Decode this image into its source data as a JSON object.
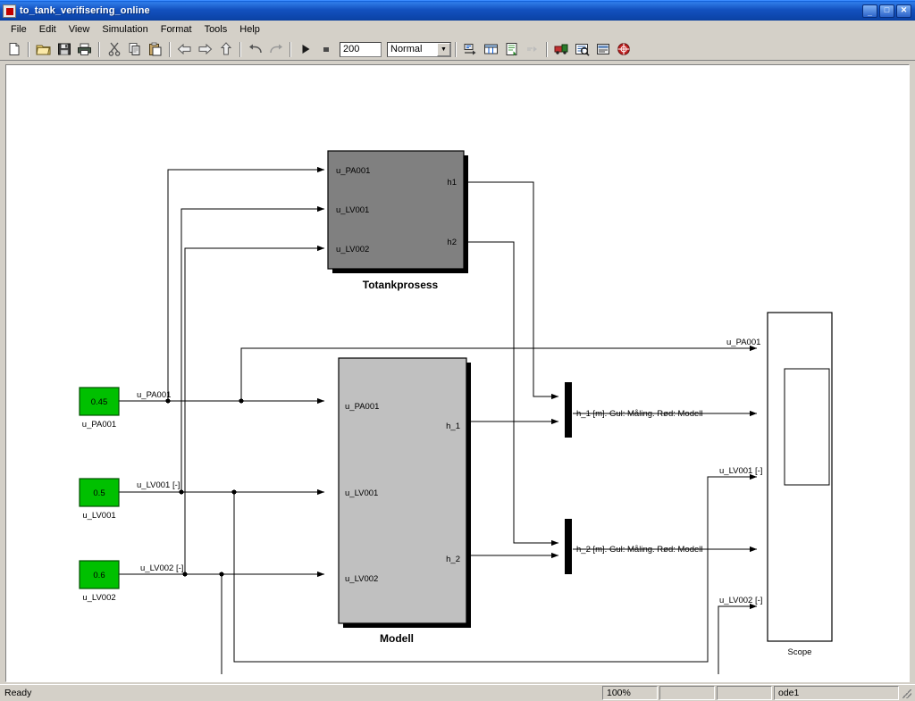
{
  "window": {
    "title": "to_tank_verifisering_online",
    "icon": "simulink-model-icon",
    "minimize": "_",
    "maximize": "□",
    "close": "✕"
  },
  "menu": {
    "items": [
      "File",
      "Edit",
      "View",
      "Simulation",
      "Format",
      "Tools",
      "Help"
    ]
  },
  "toolbar": {
    "new_label": "new-icon",
    "open_label": "open-icon",
    "save_label": "save-icon",
    "print_label": "print-icon",
    "cut_label": "cut-icon",
    "copy_label": "copy-icon",
    "paste_label": "paste-icon",
    "back_label": "back-icon",
    "forward_label": "forward-icon",
    "up_label": "up-icon",
    "undo_label": "undo-icon",
    "redo_label": "redo-icon",
    "start_label": "start-simulation-icon",
    "stop_label": "stop-simulation-icon",
    "stop_time": "200",
    "sim_mode": "Normal",
    "sim_mode_arrow": "▼"
  },
  "statusbar": {
    "status": "Ready",
    "zoom": "100%",
    "field_b": "",
    "field_c": "",
    "solver": "ode1"
  },
  "diagram": {
    "blocks": [
      {
        "id": "totankprosess",
        "name": "Totankprosess",
        "fill": "#808080",
        "inputs": [
          "u_PA001",
          "u_LV001",
          "u_LV002"
        ],
        "outputs": [
          "h1",
          "h2"
        ]
      },
      {
        "id": "modell",
        "name": "Modell",
        "fill": "#c0c0c0",
        "inputs": [
          "u_PA001",
          "u_LV001",
          "u_LV002"
        ],
        "outputs": [
          "h_1",
          "h_2"
        ]
      },
      {
        "id": "scope",
        "name": "Scope",
        "fill": "#ffffff"
      }
    ],
    "constants": [
      {
        "id": "const_pa001",
        "value": "0.45",
        "name": "u_PA001",
        "fill": "#00c000"
      },
      {
        "id": "const_lv001",
        "value": "0.5",
        "name": "u_LV001",
        "fill": "#00c000"
      },
      {
        "id": "const_lv002",
        "value": "0.6",
        "name": "u_LV002",
        "fill": "#00c000"
      }
    ],
    "signal_labels": {
      "pa001_src": "u_PA001",
      "lv001_src": "u_LV001 [-]",
      "lv002_src": "u_LV002 [-]",
      "mux1": "h_1 [m]. Gul: Måling. Rød: Modell",
      "mux2": "h_2 [m]. Gul: Måling. Rød: Modell",
      "scope_pa001": "u_PA001",
      "scope_lv001": "u_LV001 [-]",
      "scope_lv002": "u_LV002 [-]"
    }
  }
}
